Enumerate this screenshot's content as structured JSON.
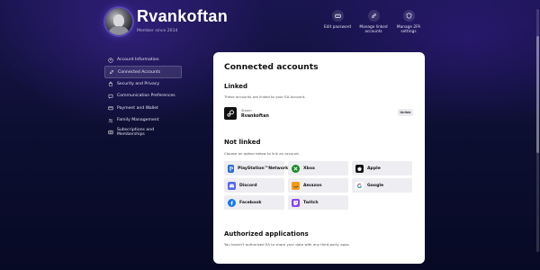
{
  "profile": {
    "username": "Rvankoftan",
    "member_since": "Member since 2014"
  },
  "quick_actions": [
    {
      "icon": "password-icon",
      "label_line1": "Edit password",
      "label_line2": ""
    },
    {
      "icon": "link-icon",
      "label_line1": "Manage linked",
      "label_line2": "accounts"
    },
    {
      "icon": "shield-icon",
      "label_line1": "Manage 2FA",
      "label_line2": "settings"
    }
  ],
  "sidebar": {
    "items": [
      {
        "label": "Account Information",
        "icon": "user-icon",
        "active": false
      },
      {
        "label": "Connected Accounts",
        "icon": "link-icon",
        "active": true
      },
      {
        "label": "Security and Privacy",
        "icon": "lock-icon",
        "active": false
      },
      {
        "label": "Communication Preferences",
        "icon": "chat-icon",
        "active": false
      },
      {
        "label": "Payment and Wallet",
        "icon": "card-icon",
        "active": false
      },
      {
        "label": "Family Management",
        "icon": "family-icon",
        "active": false
      },
      {
        "label": "Subscriptions and Memberships",
        "icon": "grid-icon",
        "active": false
      }
    ]
  },
  "main": {
    "title": "Connected accounts",
    "linked": {
      "heading": "Linked",
      "description": "These accounts are linked to your EA Account.",
      "account": {
        "platform": "Steam",
        "name": "Rvankoftan",
        "unlink_label": "Unlink"
      }
    },
    "not_linked": {
      "heading": "Not linked",
      "description": "Choose an option below to link an account.",
      "platforms": [
        {
          "name": "PlayStation™Network",
          "icon": "playstation-icon",
          "color": "#2f6fd0"
        },
        {
          "name": "Xbox",
          "icon": "xbox-icon",
          "color": "#178a24"
        },
        {
          "name": "Apple",
          "icon": "apple-icon",
          "color": "#111111"
        },
        {
          "name": "Discord",
          "icon": "discord-icon",
          "color": "#5865f2"
        },
        {
          "name": "Amazon",
          "icon": "amazon-icon",
          "color": "#f29b17"
        },
        {
          "name": "Google",
          "icon": "google-icon",
          "color": "#ffffff"
        },
        {
          "name": "Facebook",
          "icon": "facebook-icon",
          "color": "#1877f2"
        },
        {
          "name": "Twitch",
          "icon": "twitch-icon",
          "color": "#8a43f2"
        }
      ]
    },
    "authorized": {
      "heading": "Authorized applications",
      "description": "You haven't authorized EA to share your data with any third-party apps."
    }
  }
}
